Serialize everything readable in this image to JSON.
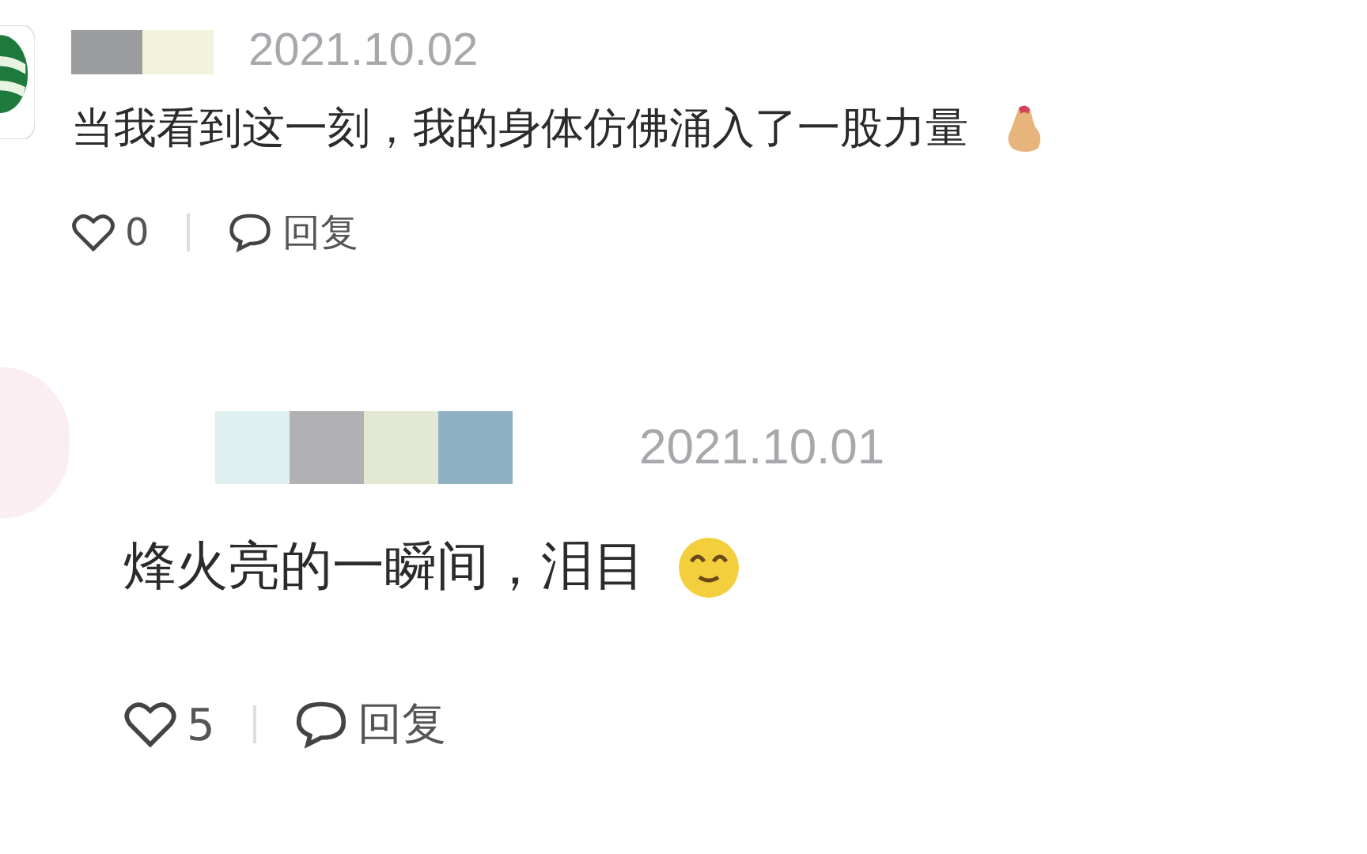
{
  "comments": [
    {
      "date": "2021.10.02",
      "text": "当我看到这一刻，我的身体仿佛涌入了一股力量",
      "likes": "0",
      "reply": "回复"
    },
    {
      "date": "2021.10.01",
      "text": "烽火亮的一瞬间，泪目",
      "likes": "5",
      "reply": "回复"
    }
  ]
}
